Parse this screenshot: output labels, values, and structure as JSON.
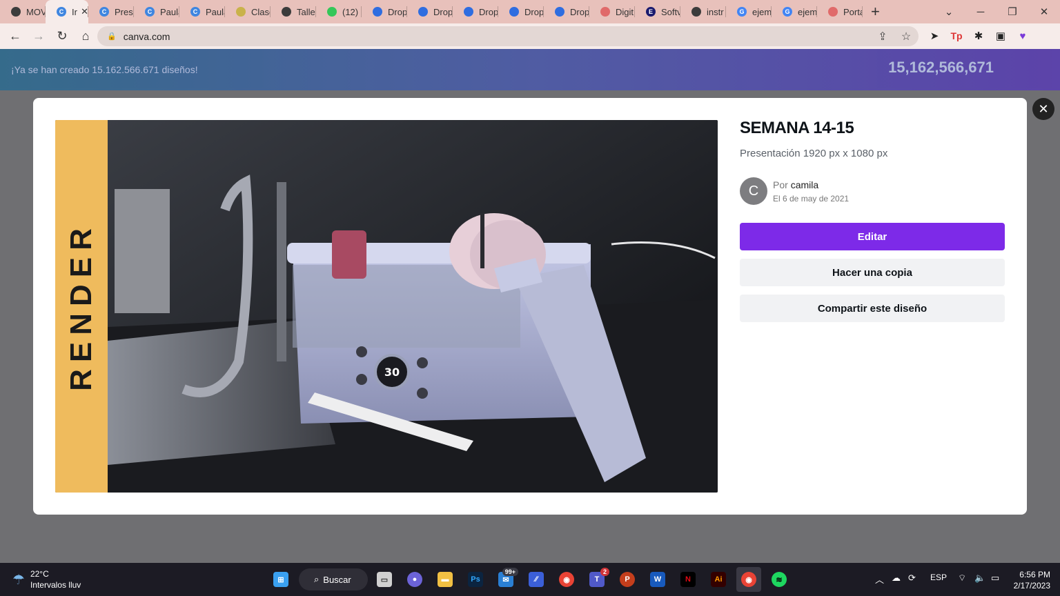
{
  "browser": {
    "tabs": [
      {
        "label": "MOV",
        "color": "#3c3c3c",
        "glyph": ""
      },
      {
        "label": "Ir",
        "color": "#3f86e0",
        "glyph": "C",
        "active": true
      },
      {
        "label": "Prese",
        "color": "#3f86e0",
        "glyph": "C"
      },
      {
        "label": "Paula",
        "color": "#3f86e0",
        "glyph": "C"
      },
      {
        "label": "Paula",
        "color": "#3f86e0",
        "glyph": "C"
      },
      {
        "label": "Clase",
        "color": "#c9b24a",
        "glyph": ""
      },
      {
        "label": "Taller",
        "color": "#3c3c3c",
        "glyph": ""
      },
      {
        "label": "(12)",
        "color": "#34c759",
        "glyph": ""
      },
      {
        "label": "Drop",
        "color": "#2f6de0",
        "glyph": ""
      },
      {
        "label": "Drop",
        "color": "#2f6de0",
        "glyph": ""
      },
      {
        "label": "Drop",
        "color": "#2f6de0",
        "glyph": ""
      },
      {
        "label": "Drop",
        "color": "#2f6de0",
        "glyph": ""
      },
      {
        "label": "Drop",
        "color": "#2f6de0",
        "glyph": ""
      },
      {
        "label": "Digit",
        "color": "#e06a6a",
        "glyph": ""
      },
      {
        "label": "Softv",
        "color": "#1a1a6e",
        "glyph": "E"
      },
      {
        "label": "instr",
        "color": "#3c3c3c",
        "glyph": ""
      },
      {
        "label": "ejem",
        "color": "#4285f4",
        "glyph": "G"
      },
      {
        "label": "ejem",
        "color": "#4285f4",
        "glyph": "G"
      },
      {
        "label": "Porta",
        "color": "#e06a6a",
        "glyph": ""
      }
    ],
    "url": "canva.com"
  },
  "banner": {
    "text": "¡Ya se han creado 15.162.566.671 diseños!",
    "counter": "15,162,566,671"
  },
  "design": {
    "sidebar_text": "RENDER",
    "title": "SEMANA 14-15",
    "subtitle": "Presentación 1920 px x 1080 px",
    "by_prefix": "Por",
    "author": "camila",
    "avatar_letter": "C",
    "date": "El 6 de may de 2021",
    "buttons": {
      "edit": "Editar",
      "copy": "Hacer una copia",
      "share": "Compartir este diseño"
    },
    "render_display": "30"
  },
  "taskbar": {
    "temperature": "22°C",
    "weather": "Intervalos lluv",
    "search": "Buscar",
    "mail_badge": "99+",
    "teams_badge": "2",
    "language": "ESP",
    "time": "6:56 PM",
    "date": "2/17/2023"
  }
}
